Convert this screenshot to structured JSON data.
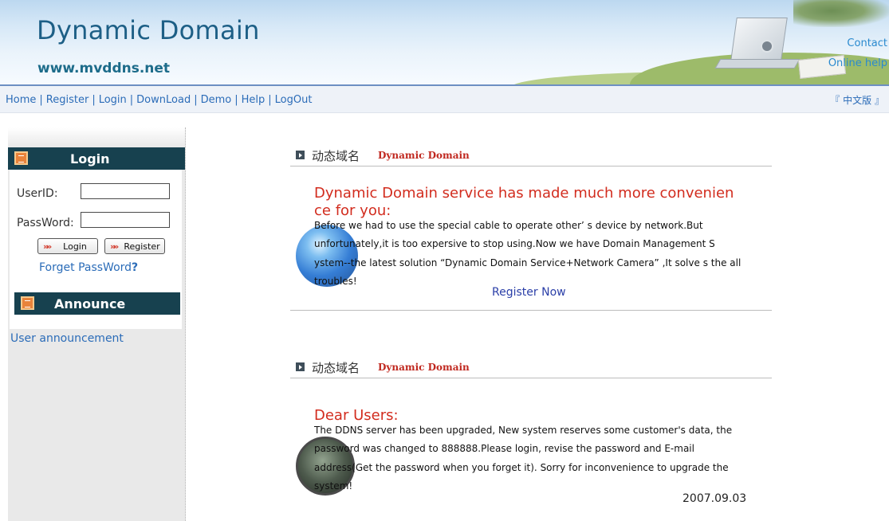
{
  "header": {
    "title": "Dynamic Domain",
    "url": "www.mvddns.net",
    "links": [
      "",
      "Contact",
      "Online help"
    ]
  },
  "nav": {
    "items": [
      "Home",
      "Register",
      "Login",
      "DownLoad",
      "Demo",
      "Help",
      "LogOut"
    ],
    "separator": "|",
    "language": "『 中文版 』"
  },
  "sidebar": {
    "login_header": "Login",
    "userid_label": "UserID:",
    "password_label": "PassWord:",
    "login_button": "Login",
    "register_button": "Register",
    "forget_password": "Forget PassWord",
    "forget_mark": "?",
    "announce_header": "Announce",
    "announcement_link": "User announcement"
  },
  "sections": [
    {
      "heading_cn": "动态域名",
      "heading_en": "Dynamic Domain",
      "title": "Dynamic Domain service has made much more convenien ce for you:",
      "body": "Before we had to use the special cable to operate other’ s device by network.But unfortunately,it is too expersive to stop using.Now we have Domain Management S ystem--the latest solution “Dynamic Domain Service+Network Camera” ,It solve s the all troubles!",
      "link": "Register Now"
    },
    {
      "heading_cn": "动态域名",
      "heading_en": "Dynamic Domain",
      "title": "Dear Users:",
      "body": "The DDNS server has been upgraded, New system reserves some customer's data, the password was changed to 888888.Please login, revise the password and E-mail address(Get the password when you forget it). Sorry for inconvenience to upgrade the system!",
      "date": "2007.09.03"
    }
  ],
  "icons": {
    "section_bullet": "play-square-icon",
    "sidebar_header": "document-icon",
    "button_mark": "double-arrow-icon",
    "globe": "globe-icon",
    "radar": "radar-icon"
  },
  "colors": {
    "brand_blue": "#1d5f86",
    "link_blue": "#2b6cb8",
    "headline_red": "#d22c1e",
    "sidebar_header_bg": "#17414f"
  }
}
